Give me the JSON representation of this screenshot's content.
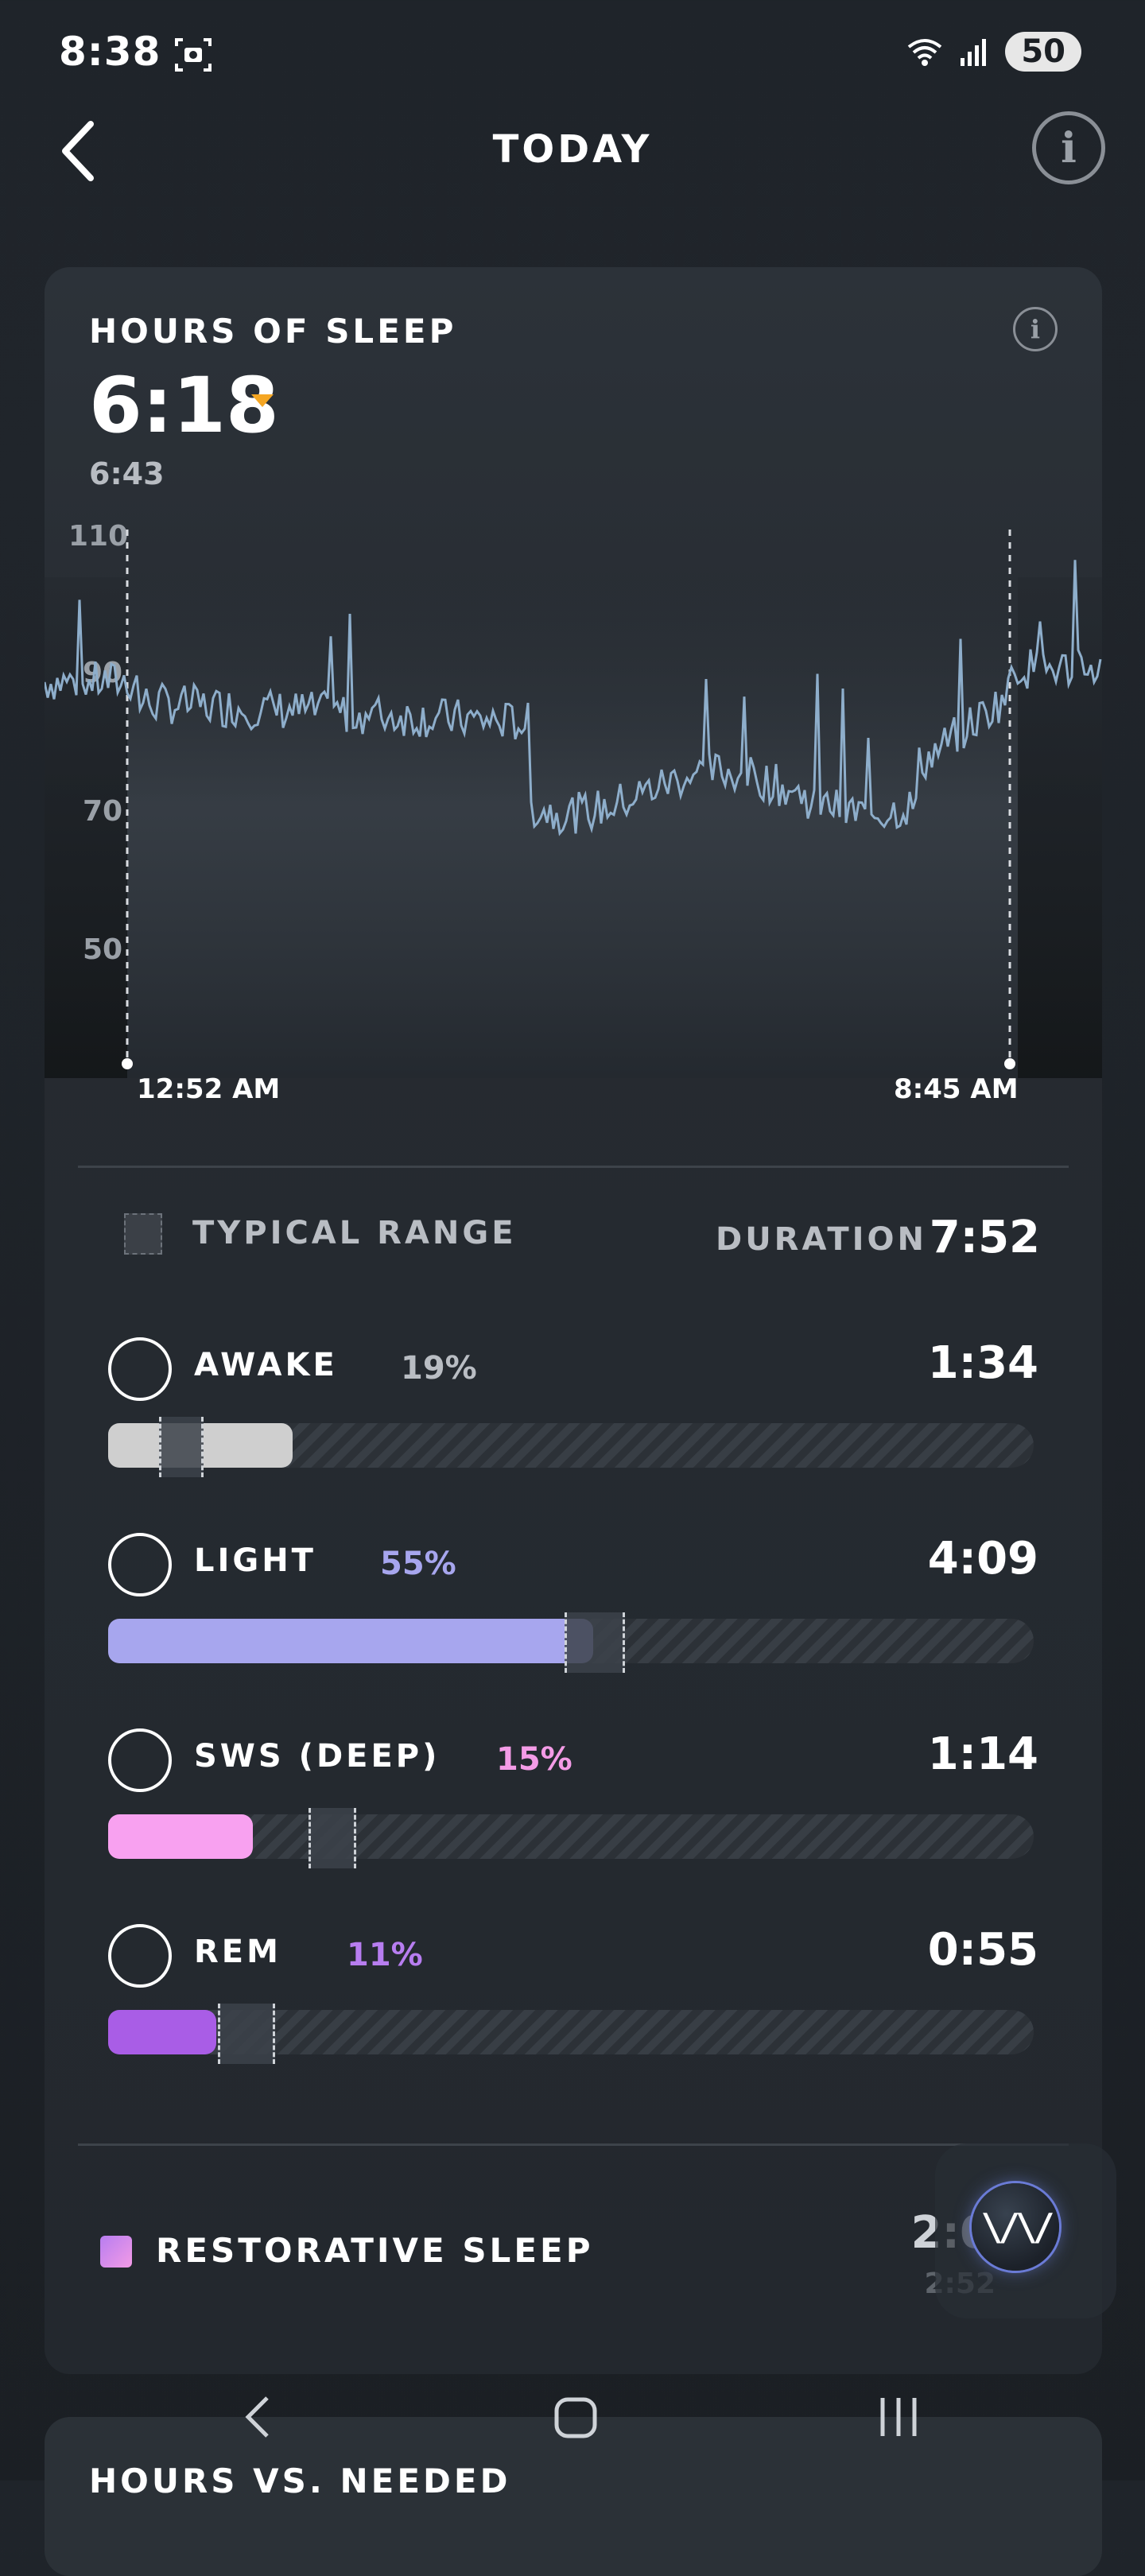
{
  "status_bar": {
    "time": "8:38",
    "battery": "50"
  },
  "header": {
    "title": "TODAY"
  },
  "card": {
    "title": "HOURS OF SLEEP",
    "hours_value": "6:18",
    "previous_value": "6:43",
    "chart": {
      "y_ticks": [
        "110",
        "90",
        "70",
        "50"
      ],
      "start_label": "12:52 AM",
      "end_label": "8:45 AM"
    },
    "typical_range_label": "TYPICAL RANGE",
    "duration_label": "DURATION",
    "duration_value": "7:52",
    "stages": [
      {
        "name": "AWAKE",
        "percent": "19%",
        "time": "1:34",
        "fill": 0.2,
        "color": "#cfcfcf",
        "pct_color": "#b9bdc3"
      },
      {
        "name": "LIGHT",
        "percent": "55%",
        "time": "4:09",
        "fill": 0.525,
        "color": "#a7a6ee",
        "pct_color": "#a7a6ee"
      },
      {
        "name": "SWS (DEEP)",
        "percent": "15%",
        "time": "1:14",
        "fill": 0.157,
        "color": "#f8a1f0",
        "pct_color": "#f39be6"
      },
      {
        "name": "REM",
        "percent": "11%",
        "time": "0:55",
        "fill": 0.117,
        "color": "#a95de6",
        "pct_color": "#b77df0"
      }
    ],
    "restorative_label": "RESTORATIVE SLEEP",
    "restorative_value": "2:0",
    "restorative_sub": "2:52"
  },
  "next_card": {
    "title": "HOURS VS. NEEDED"
  },
  "colors": {
    "accent_orange": "#f5a623",
    "hr_line": "#8eaecb"
  }
}
